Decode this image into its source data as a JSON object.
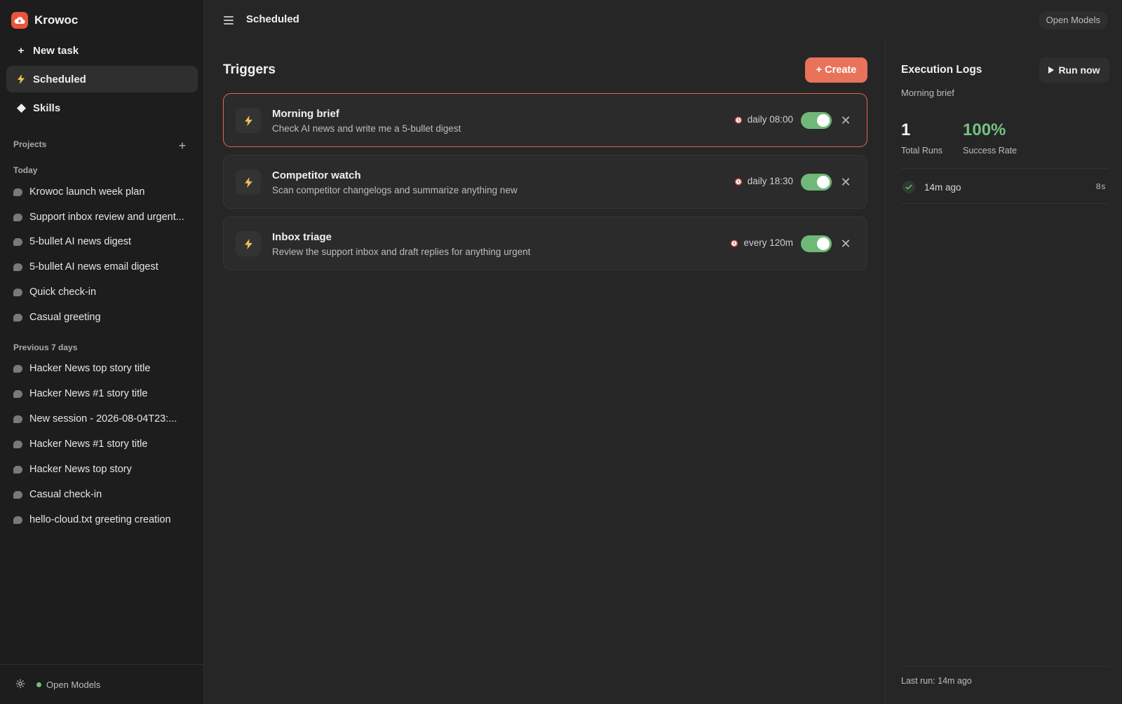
{
  "app": {
    "name": "Krowoc"
  },
  "sidebar": {
    "new_task": "New task",
    "nav": [
      {
        "label": "Scheduled",
        "icon": "bolt-icon"
      },
      {
        "label": "Skills",
        "icon": "diamond-icon"
      }
    ],
    "projects_label": "Projects",
    "today_label": "Today",
    "today": [
      "Krowoc launch week plan",
      "Support inbox review and urgent...",
      "5-bullet AI news digest",
      "5-bullet AI news email digest",
      "Quick check-in",
      "Casual greeting"
    ],
    "previous_label": "Previous 7 days",
    "previous": [
      "Hacker News top story title",
      "Hacker News #1 story title",
      "New session - 2026-08-04T23:...",
      "Hacker News #1 story title",
      "Hacker News top story",
      "Casual check-in",
      "hello-cloud.txt greeting creation"
    ],
    "footer_model": "Open Models"
  },
  "header": {
    "title": "Scheduled",
    "model_label": "Open Models"
  },
  "triggers": {
    "title": "Triggers",
    "create_label": "+ Create",
    "items": [
      {
        "name": "Morning brief",
        "description": "Check AI news and write me a 5-bullet digest",
        "schedule": "daily 08:00",
        "enabled": true,
        "selected": true
      },
      {
        "name": "Competitor watch",
        "description": "Scan competitor changelogs and summarize anything new",
        "schedule": "daily 18:30",
        "enabled": true,
        "selected": false
      },
      {
        "name": "Inbox triage",
        "description": "Review the support inbox and draft replies for anything urgent",
        "schedule": "every 120m",
        "enabled": true,
        "selected": false
      }
    ]
  },
  "logs": {
    "title": "Execution Logs",
    "run_label": "Run now",
    "subtitle": "Morning brief",
    "total_runs": "1",
    "total_runs_label": "Total Runs",
    "success_rate": "100%",
    "success_rate_label": "Success Rate",
    "entries": [
      {
        "time": "14m ago",
        "duration": "8s",
        "status": "success"
      }
    ],
    "last_run": "Last run: 14m ago"
  },
  "colors": {
    "accent": "#e8735a",
    "toggle_on": "#6fb877",
    "success": "#75c280",
    "brand": "#e9553a"
  }
}
